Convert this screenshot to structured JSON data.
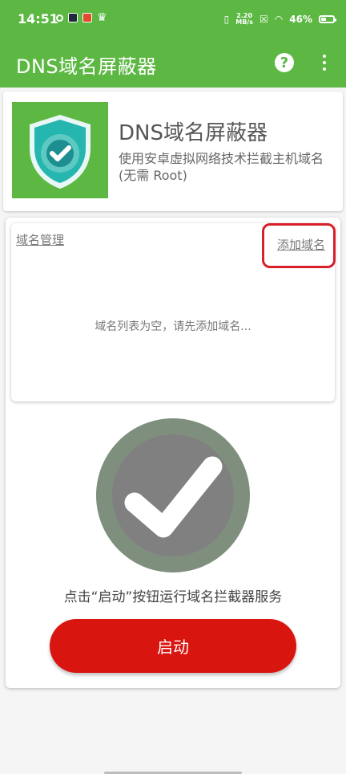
{
  "status_bar": {
    "time": "14:51",
    "network_speed_value": "2.20",
    "network_speed_unit": "MB/s",
    "battery_percent_text": "46%",
    "battery_level": 0.46
  },
  "app_bar": {
    "title": "DNS域名屏蔽器",
    "help_icon": "help-circle-icon",
    "more_icon": "more-vert-icon"
  },
  "header": {
    "title": "DNS域名屏蔽器",
    "description": "使用安卓虚拟网络技术拦截主机域名 (无需 Root)",
    "logo_icon": "shield-check-icon"
  },
  "domains": {
    "title": "域名管理",
    "add_label": "添加域名",
    "empty_message": "域名列表为空，请先添加域名..."
  },
  "service": {
    "status_icon": "check-circle-icon",
    "instruction": "点击“启动”按钮运行域名拦截器服务",
    "start_button": "启动"
  },
  "colors": {
    "primary_green": "#5cb843",
    "danger_red": "#d9150f",
    "highlight_red": "#d91f2a",
    "icon_gray": "#7f8f7e"
  }
}
